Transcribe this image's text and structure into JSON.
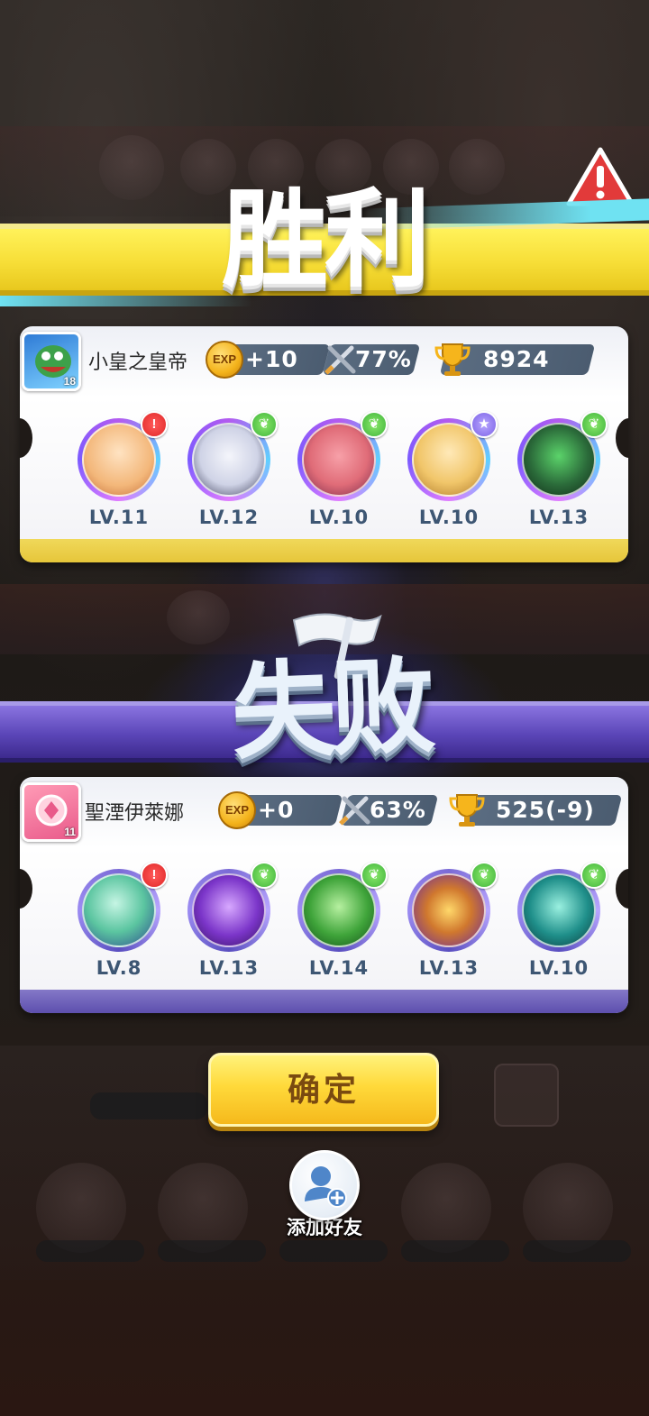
{
  "victory": {
    "title": "胜利",
    "player": {
      "name": "小皇之皇帝",
      "level": "18",
      "exp_icon": "EXP",
      "exp": "+10",
      "win_rate": "77%",
      "trophies": "8924"
    },
    "units": [
      {
        "level": "LV.11",
        "badge": "red",
        "badge_icon": "up-arrow-icon",
        "color": "#f3b77a"
      },
      {
        "level": "LV.12",
        "badge": "green",
        "badge_icon": "wing-icon",
        "color": "#cfd3e6"
      },
      {
        "level": "LV.10",
        "badge": "green",
        "badge_icon": "wing-icon",
        "color": "#e06c78"
      },
      {
        "level": "LV.10",
        "badge": "purple",
        "badge_icon": "star-icon",
        "color": "#f1c66a"
      },
      {
        "level": "LV.13",
        "badge": "green",
        "badge_icon": "wing-icon",
        "color": "#2b6b3a"
      }
    ]
  },
  "defeat": {
    "title": "失败",
    "player": {
      "name": "聖湮伊萊娜",
      "level": "11",
      "exp_icon": "EXP",
      "exp": "+0",
      "win_rate": "63%",
      "trophies": "525(-9)"
    },
    "units": [
      {
        "level": "LV.8",
        "badge": "red",
        "badge_icon": "up-arrow-icon",
        "color": "#5bc5a0"
      },
      {
        "level": "LV.13",
        "badge": "green",
        "badge_icon": "wing-icon",
        "color": "#7b35c9"
      },
      {
        "level": "LV.14",
        "badge": "green",
        "badge_icon": "wing-icon",
        "color": "#3fa43a"
      },
      {
        "level": "LV.13",
        "badge": "green",
        "badge_icon": "wing-icon",
        "color": "#d0782e"
      },
      {
        "level": "LV.10",
        "badge": "green",
        "badge_icon": "wing-icon",
        "color": "#1f8f8a"
      }
    ]
  },
  "buttons": {
    "confirm": "确定",
    "add_friend": "添加好友"
  },
  "colors": {
    "victory_banner": "#f7de37",
    "defeat_banner": "#5b46b8",
    "confirm_button": "#ffd93a"
  }
}
